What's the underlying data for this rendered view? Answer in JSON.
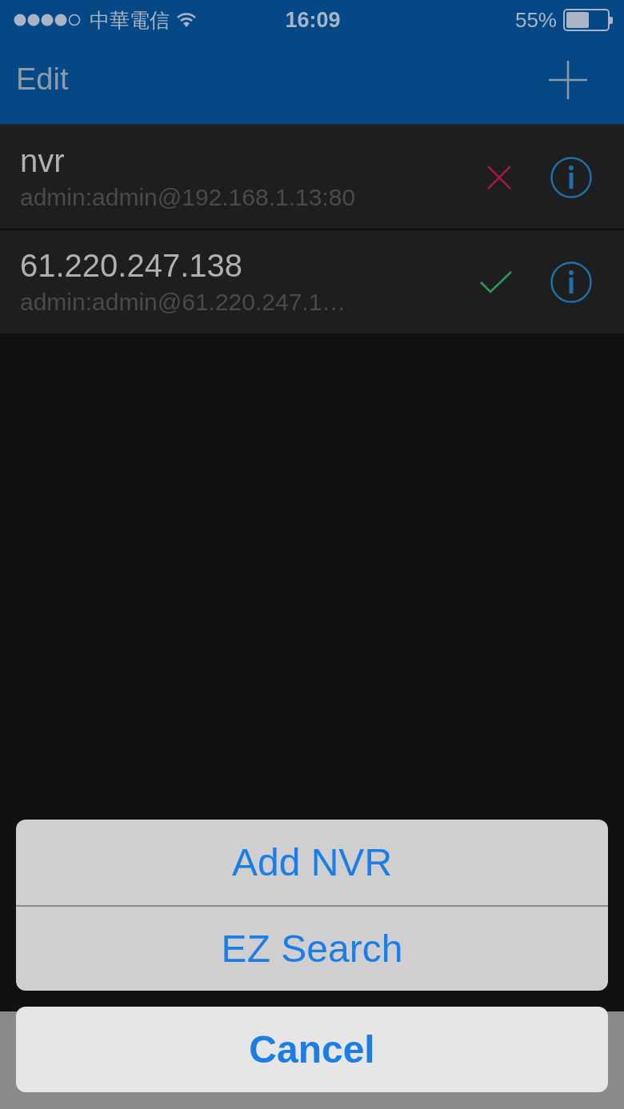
{
  "status_bar": {
    "carrier": "中華電信",
    "time": "16:09",
    "battery": "55%",
    "level": 0.55
  },
  "nav": {
    "edit": "Edit"
  },
  "devices": [
    {
      "name": "nvr",
      "address": "admin:admin@192.168.1.13:80",
      "connected": false
    },
    {
      "name": "61.220.247.138",
      "address": "admin:admin@61.220.247.1…",
      "connected": true
    }
  ],
  "action_sheet": {
    "actions": [
      "Add NVR",
      "EZ Search"
    ],
    "cancel": "Cancel"
  }
}
